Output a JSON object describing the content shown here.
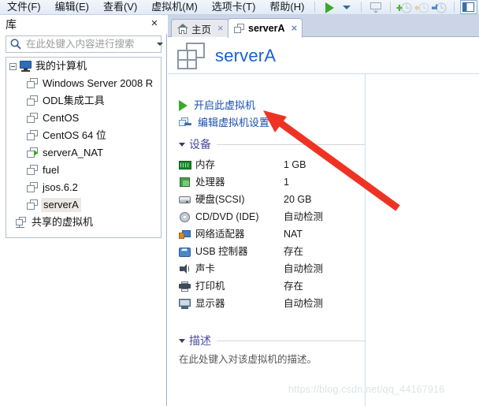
{
  "menu": {
    "items": [
      {
        "label": "文件(F)",
        "name": "menu-file"
      },
      {
        "label": "编辑(E)",
        "name": "menu-edit"
      },
      {
        "label": "查看(V)",
        "name": "menu-view"
      },
      {
        "label": "虚拟机(M)",
        "name": "menu-vm"
      },
      {
        "label": "选项卡(T)",
        "name": "menu-tabs"
      },
      {
        "label": "帮助(H)",
        "name": "menu-help"
      }
    ]
  },
  "toolbar": {
    "power_on": "play-icon",
    "power_dropdown": "caret-down-icon",
    "snapshot": "snapshot-icon",
    "snapshot_take": "take-snapshot-icon",
    "snapshot_revert": "revert-snapshot-icon",
    "snapshot_manager": "snapshot-manager-icon",
    "show_library": "show-library-panel-icon"
  },
  "sidebar": {
    "title": "库",
    "close_label": "×",
    "search": {
      "placeholder": "在此处键入内容进行搜索",
      "value": ""
    },
    "tree": [
      {
        "label": "我的计算机",
        "icon": "monitor-icon",
        "level": 0,
        "expanded": true,
        "selected": false,
        "running": false
      },
      {
        "label": "Windows Server 2008 R",
        "icon": "vm-icon",
        "level": 1,
        "selected": false,
        "running": false
      },
      {
        "label": "ODL集成工具",
        "icon": "vm-icon",
        "level": 1,
        "selected": false,
        "running": false
      },
      {
        "label": "CentOS",
        "icon": "vm-icon",
        "level": 1,
        "selected": false,
        "running": false
      },
      {
        "label": "CentOS 64 位",
        "icon": "vm-icon",
        "level": 1,
        "selected": false,
        "running": false
      },
      {
        "label": "serverA_NAT",
        "icon": "vm-icon",
        "level": 1,
        "selected": false,
        "running": true
      },
      {
        "label": "fuel",
        "icon": "vm-icon",
        "level": 1,
        "selected": false,
        "running": false
      },
      {
        "label": "jsos.6.2",
        "icon": "vm-icon",
        "level": 1,
        "selected": false,
        "running": false
      },
      {
        "label": "serverA",
        "icon": "vm-icon",
        "level": 1,
        "selected": true,
        "running": false
      },
      {
        "label": "共享的虚拟机",
        "icon": "shared-vm-icon",
        "level": 0,
        "selected": false,
        "running": false
      }
    ]
  },
  "tabs": [
    {
      "label": "主页",
      "icon": "home-icon",
      "active": false,
      "close": "×"
    },
    {
      "label": "serverA",
      "icon": "vm-icon",
      "active": true,
      "close": "×"
    }
  ],
  "vm": {
    "title": "serverA",
    "icon": "vm-large-icon",
    "title_color": "#1a5fd4",
    "actions": [
      {
        "label": "开启此虚拟机",
        "icon": "play-icon",
        "name": "power-on-vm-link"
      },
      {
        "label": "编辑虚拟机设置",
        "icon": "vm-settings-icon",
        "name": "edit-vm-settings-link"
      }
    ],
    "devices_section": {
      "title": "设备",
      "expanded": true,
      "items": [
        {
          "name": "内存",
          "value": "1 GB",
          "icon": "memory-icon"
        },
        {
          "name": "处理器",
          "value": "1",
          "icon": "cpu-icon"
        },
        {
          "name": "硬盘(SCSI)",
          "value": "20 GB",
          "icon": "harddisk-icon"
        },
        {
          "name": "CD/DVD (IDE)",
          "value": "自动检测",
          "icon": "cd-dvd-icon"
        },
        {
          "name": "网络适配器",
          "value": "NAT",
          "icon": "network-adapter-icon"
        },
        {
          "name": "USB 控制器",
          "value": "存在",
          "icon": "usb-controller-icon"
        },
        {
          "name": "声卡",
          "value": "自动检测",
          "icon": "sound-card-icon"
        },
        {
          "name": "打印机",
          "value": "存在",
          "icon": "printer-icon"
        },
        {
          "name": "显示器",
          "value": "自动检测",
          "icon": "display-icon"
        }
      ]
    },
    "description_section": {
      "title": "描述",
      "expanded": true,
      "placeholder": "在此处键入对该虚拟机的描述。"
    }
  },
  "annotation": {
    "arrow_color": "#ee3324"
  },
  "watermark": "https://blog.csdn.net/qq_44167916"
}
